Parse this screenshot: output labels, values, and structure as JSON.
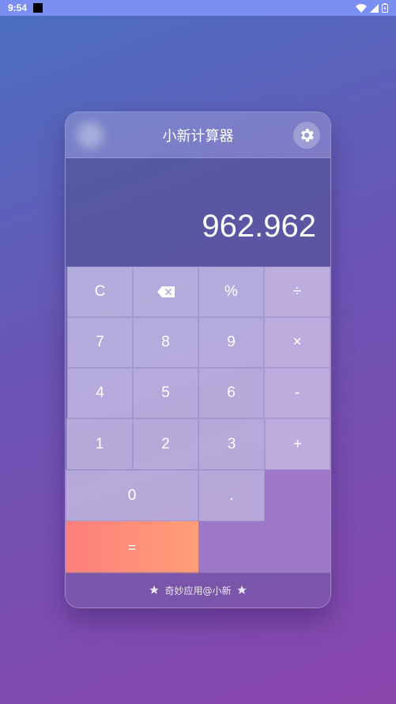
{
  "status_bar": {
    "time": "9:54"
  },
  "app": {
    "title": "小新计算器",
    "display_value": "962.962",
    "footer_text": "奇妙应用@小新"
  },
  "keys": {
    "clear": "C",
    "percent": "%",
    "divide": "÷",
    "seven": "7",
    "eight": "8",
    "nine": "9",
    "multiply": "×",
    "four": "4",
    "five": "5",
    "six": "6",
    "minus": "-",
    "one": "1",
    "two": "2",
    "three": "3",
    "plus": "+",
    "zero": "0",
    "dot": ".",
    "equals": "="
  },
  "colors": {
    "status_bar": "#7b8ef2",
    "equals_start": "#fd7f7c",
    "equals_end": "#ff9e76"
  },
  "icons": {
    "settings": "gear-icon",
    "backspace": "backspace-icon",
    "footer_left": "star-icon",
    "footer_right": "star-icon"
  }
}
